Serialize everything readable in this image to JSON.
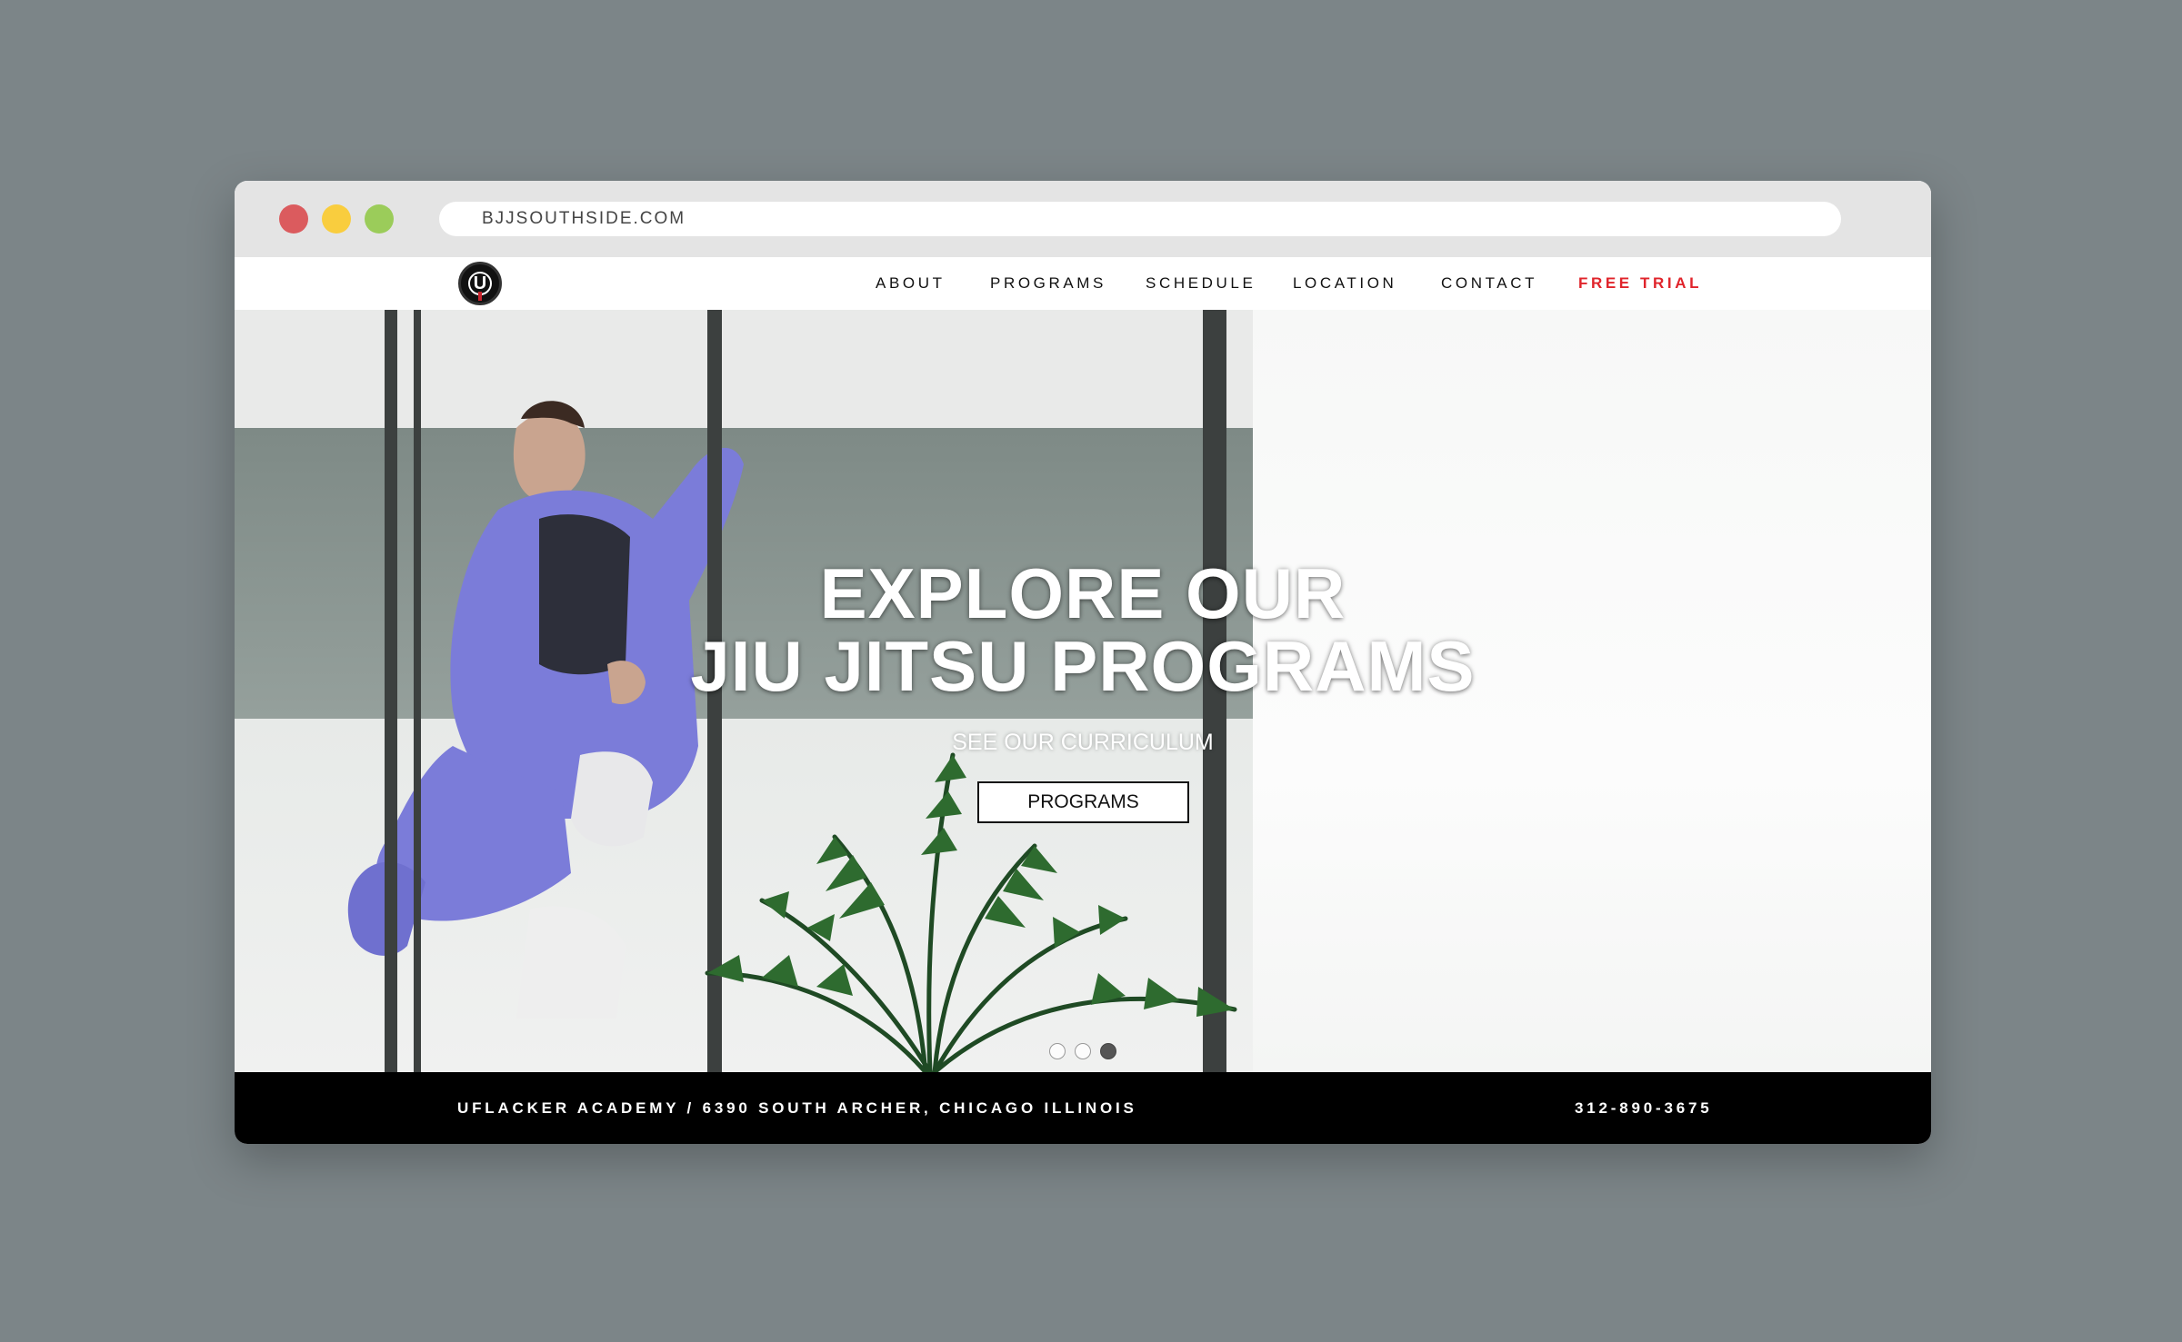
{
  "window": {
    "url": "BJJSOUTHSIDE.COM",
    "controls": [
      "close",
      "minimize",
      "maximize"
    ]
  },
  "nav": {
    "logo_icon": "academy-logo-icon",
    "items": [
      {
        "label": "ABOUT"
      },
      {
        "label": "PROGRAMS"
      },
      {
        "label": "SCHEDULE"
      },
      {
        "label": "LOCATION"
      },
      {
        "label": "CONTACT"
      },
      {
        "label": "FREE TRIAL"
      }
    ],
    "highlight_color": "#e0242b"
  },
  "hero": {
    "title_line1": "EXPLORE OUR",
    "title_line2": "JIU JITSU PROGRAMS",
    "subtitle": "SEE OUR CURRICULUM",
    "button_label": "PROGRAMS",
    "slides_total": 3,
    "active_slide": 3
  },
  "footer": {
    "address": "UFLACKER ACADEMY / 6390 SOUTH ARCHER, CHICAGO ILLINOIS",
    "phone": "312-890-3675"
  },
  "colors": {
    "background": "#7c8588",
    "footer": "#000000",
    "accent": "#e0242b",
    "close_dot": "#db5b5e",
    "minimize_dot": "#f9cd3e",
    "maximize_dot": "#9bcc5a"
  }
}
